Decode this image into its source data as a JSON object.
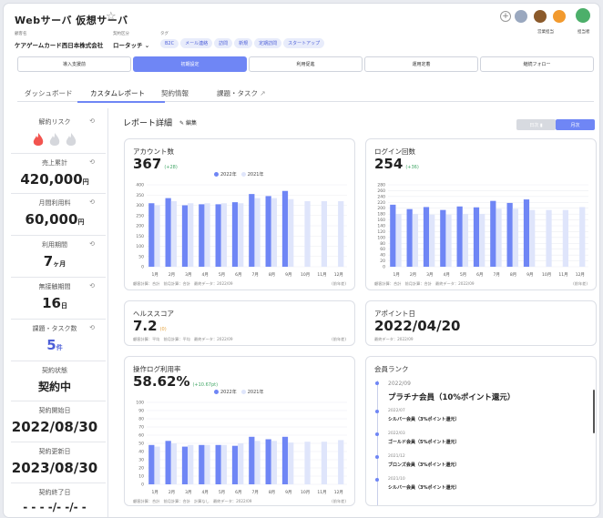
{
  "header": {
    "title": "Webサーバ 仮想サーバ",
    "customer_label": "顧客名",
    "customer_value": "ケアゲームカード西日本株式会社",
    "contract_label": "契約区分",
    "contract_value": "ロータッチ",
    "tags_label": "タグ",
    "tags": [
      "B2C",
      "メール連絡",
      "訪問",
      "新規",
      "定期訪問",
      "スタートアップ"
    ],
    "sales_label": "営業担当",
    "support_label": "担当者"
  },
  "steps": [
    "導入支援前",
    "初期設定",
    "利用促進",
    "運用定着",
    "継続フォロー"
  ],
  "active_step": 1,
  "tabs": [
    "ダッシュボード",
    "カスタムレポート",
    "契約情報",
    "課題・タスク"
  ],
  "active_tab": 1,
  "sidebar": [
    {
      "label": "解約リスク",
      "value": "",
      "unit": ""
    },
    {
      "label": "売上累計",
      "value": "420,000",
      "unit": "円"
    },
    {
      "label": "月間利用料",
      "value": "60,000",
      "unit": "円"
    },
    {
      "label": "利用期間",
      "value": "7",
      "unit": "ヶ月"
    },
    {
      "label": "無接触期間",
      "value": "16",
      "unit": "日"
    },
    {
      "label": "課題・タスク数",
      "value": "5",
      "unit": "件"
    },
    {
      "label": "契約状態",
      "value": "契約中",
      "unit": ""
    },
    {
      "label": "契約開始日",
      "value": "2022/08/30",
      "unit": ""
    },
    {
      "label": "契約更新日",
      "value": "2023/08/30",
      "unit": ""
    },
    {
      "label": "契約終了日",
      "value": "- - - -/- -/- -",
      "unit": ""
    }
  ],
  "report": {
    "title": "レポート詳細",
    "edit_label": "編集",
    "toggle_left": "日次 ▮",
    "toggle_right": "月次"
  },
  "cards": {
    "accounts": {
      "title": "アカウント数",
      "value": "367",
      "delta": "(+28)",
      "foot_left": "顧客計算：合計　前月計算：合計　最終データ：2022/09",
      "foot_right": "(前年差)"
    },
    "logins": {
      "title": "ログイン回数",
      "value": "254",
      "delta": "(+36)",
      "foot_left": "顧客計算：合計　前月計算：合計　最終データ：2022/09",
      "foot_right": "(前年差)"
    },
    "health": {
      "title": "ヘルススコア",
      "value": "7.2",
      "delta": "(0)",
      "foot_left": "顧客計算：平均　前月計算：平均　最終データ：2022/09",
      "foot_right": "(前年差)"
    },
    "appoint": {
      "title": "アポイント日",
      "value": "2022/04/20",
      "foot_left": "最終データ：2022/09"
    },
    "oplog": {
      "title": "操作ログ利用率",
      "value": "58.62%",
      "delta": "(+10.67pt)",
      "foot_left": "顧客計算：合計　前月計算：合計　計算なし　最終データ：2022/09",
      "foot_right": "(前年差)"
    },
    "rank": {
      "title": "会員ランク",
      "entries": [
        {
          "date": "2022/09",
          "name": "プラチナ会員（10%ポイント還元）"
        },
        {
          "date": "2022/07",
          "name": "シルバー会員（3%ポイント還元）"
        },
        {
          "date": "2022/03",
          "name": "ゴールド会員（5%ポイント還元）"
        },
        {
          "date": "2021/12",
          "name": "ブロンズ会員（3%ポイント還元）"
        },
        {
          "date": "2021/10",
          "name": "シルバー会員（3%ポイント還元）"
        }
      ]
    }
  },
  "colors": {
    "accent": "#6f86f5",
    "prev": "#dfe5fb",
    "risk": "#f2544f"
  },
  "chart_data": [
    {
      "type": "bar",
      "title": "アカウント数",
      "categories": [
        "1月",
        "2月",
        "3月",
        "4月",
        "5月",
        "6月",
        "7月",
        "8月",
        "9月",
        "10月",
        "11月",
        "12月"
      ],
      "series": [
        {
          "name": "2022年",
          "values": [
            310,
            335,
            300,
            305,
            305,
            315,
            355,
            345,
            370,
            null,
            null,
            null
          ]
        },
        {
          "name": "2021年",
          "values": [
            300,
            320,
            310,
            310,
            310,
            310,
            335,
            335,
            330,
            320,
            320,
            320
          ]
        }
      ],
      "ylim": [
        0,
        400
      ],
      "yticks": [
        0,
        50,
        100,
        150,
        200,
        250,
        300,
        350,
        400
      ]
    },
    {
      "type": "bar",
      "title": "ログイン回数",
      "categories": [
        "1月",
        "2月",
        "3月",
        "4月",
        "5月",
        "6月",
        "7月",
        "8月",
        "9月",
        "10月",
        "11月",
        "12月"
      ],
      "series": [
        {
          "name": "2022年",
          "values": [
            212,
            197,
            204,
            194,
            206,
            203,
            225,
            218,
            230,
            null,
            null,
            null
          ]
        },
        {
          "name": "2021年",
          "values": [
            180,
            180,
            178,
            178,
            180,
            180,
            198,
            198,
            194,
            194,
            194,
            204
          ]
        }
      ],
      "ylim": [
        0,
        280
      ],
      "yticks": [
        0,
        20,
        40,
        60,
        80,
        100,
        120,
        140,
        160,
        180,
        200,
        220,
        240,
        260,
        280
      ]
    },
    {
      "type": "bar",
      "title": "操作ログ利用率",
      "categories": [
        "1月",
        "2月",
        "3月",
        "4月",
        "5月",
        "6月",
        "7月",
        "8月",
        "9月",
        "10月",
        "11月",
        "12月"
      ],
      "series": [
        {
          "name": "2022年",
          "values": [
            48,
            53,
            46,
            48,
            48,
            47,
            58,
            55,
            58,
            null,
            null,
            null
          ]
        },
        {
          "name": "2021年",
          "values": [
            46,
            50,
            48,
            48,
            48,
            50,
            53,
            53,
            51,
            52,
            52,
            54
          ]
        }
      ],
      "ylim": [
        0,
        100
      ],
      "yticks": [
        0,
        10,
        20,
        30,
        40,
        50,
        60,
        70,
        80,
        90,
        100
      ]
    }
  ]
}
